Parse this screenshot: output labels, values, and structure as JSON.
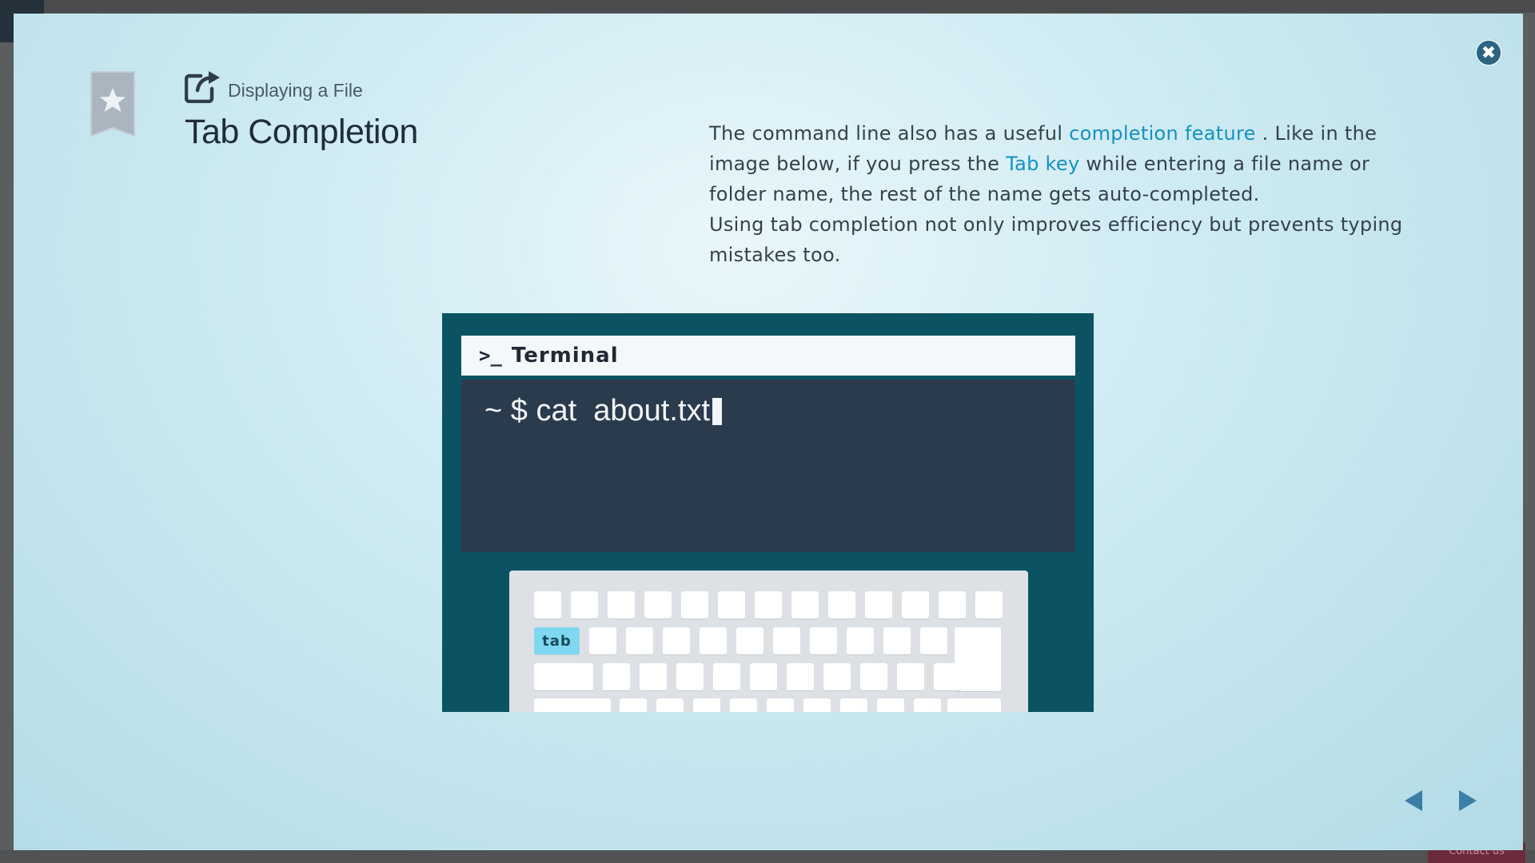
{
  "lesson": {
    "breadcrumb": "Displaying a File",
    "title": "Tab Completion"
  },
  "description": {
    "p1_part1": "The command line also has a useful ",
    "p1_link1": "completion feature",
    "p1_part2": " . Like in the image below, if you press the ",
    "p1_link2": "Tab key",
    "p1_part3": " while entering a file name or folder name, the rest of the name gets auto-completed.",
    "p2": "Using tab completion not only improves efficiency but prevents typing mistakes too."
  },
  "terminal": {
    "prompt_symbol": ">_",
    "title": "Terminal",
    "command_line": "~ $ cat  about.txt"
  },
  "keyboard": {
    "highlighted_key": "tab"
  },
  "background": {
    "contact_label": "Contact us"
  },
  "icons": {
    "close": "close-icon",
    "bookmark": "bookmark-star-icon",
    "external": "external-link-icon",
    "prev": "arrow-left-icon",
    "next": "arrow-right-icon"
  },
  "colors": {
    "accent_link": "#1592c2",
    "illustration_bg": "#0b5363",
    "terminal_bg": "#2b3b4e",
    "tab_key": "#7fd7f0",
    "nav_arrow": "#3a7fa6"
  }
}
